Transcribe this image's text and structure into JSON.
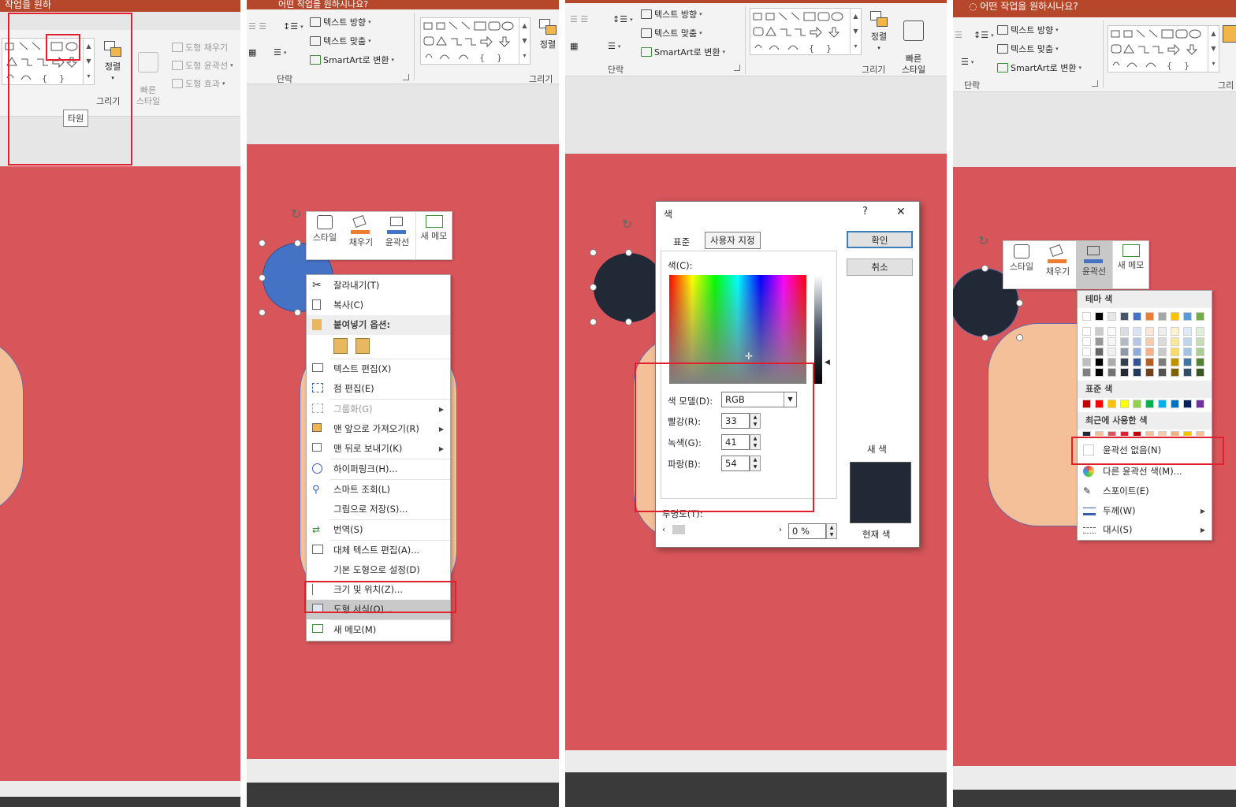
{
  "colors": {
    "title_bar": "#b7472a",
    "slide_bg": "#d8565a",
    "peach": "#f4c09a",
    "blue_circle": "#4472c4",
    "navy": "#212936",
    "highlight_red": "#e0202c"
  },
  "panel1": {
    "title_fragment": "작업을 원하",
    "arrange_label": "정렬",
    "quick_styles_label": "빠른\n스타일",
    "shape_fill": "도형 채우기",
    "shape_outline": "도형 윤곽선",
    "shape_effects": "도형 효과",
    "group_label": "그리기",
    "tooltip": "타원"
  },
  "panel2": {
    "title_fragment": "어떤 작업을 원하시나요?",
    "text_direction": "텍스트 방향",
    "align_text": "텍스트 맞춤",
    "smartart": "SmartArt로 변환",
    "paragraph_label": "단락",
    "drawing_label": "그리기",
    "arrange_label": "정렬",
    "minitoolbar": [
      "스타일",
      "채우기",
      "윤곽선",
      "새 메모"
    ],
    "context_menu": [
      {
        "label": "잘라내기(T)",
        "icon": "scissors-icon"
      },
      {
        "label": "복사(C)",
        "icon": "copy-icon"
      },
      {
        "label": "붙여넣기 옵션:",
        "icon": "paste-icon",
        "header": true
      },
      {
        "label": "텍스트 편집(X)",
        "icon": "edit-text-icon"
      },
      {
        "label": "점 편집(E)",
        "icon": "edit-points-icon"
      },
      {
        "label": "그룹화(G)",
        "icon": "group-icon",
        "disabled": true,
        "submenu": true
      },
      {
        "label": "맨 앞으로 가져오기(R)",
        "icon": "bring-front-icon",
        "submenu": true
      },
      {
        "label": "맨 뒤로 보내기(K)",
        "icon": "send-back-icon",
        "submenu": true
      },
      {
        "label": "하이퍼링크(H)...",
        "icon": "hyperlink-icon"
      },
      {
        "label": "스마트 조회(L)",
        "icon": "smart-lookup-icon"
      },
      {
        "label": "그림으로 저장(S)...",
        "icon": ""
      },
      {
        "label": "번역(S)",
        "icon": "translate-icon"
      },
      {
        "label": "대체 텍스트 편집(A)...",
        "icon": "alt-text-icon"
      },
      {
        "label": "기본 도형으로 설정(D)",
        "icon": ""
      },
      {
        "label": "크기 및 위치(Z)...",
        "icon": "size-position-icon"
      },
      {
        "label": "도형 서식(O)...",
        "icon": "format-shape-icon",
        "highlight": true
      },
      {
        "label": "새 메모(M)",
        "icon": "new-comment-icon"
      }
    ]
  },
  "panel3": {
    "text_direction": "텍스트 방향",
    "align_text": "텍스트 맞춤",
    "smartart": "SmartArt로 변환",
    "paragraph_label": "단락",
    "drawing_label": "그리기",
    "arrange_label": "정렬",
    "quick_styles_label": "빠른\n스타일",
    "dialog": {
      "title": "색",
      "help": "?",
      "close": "✕",
      "tab_standard": "표준",
      "tab_custom": "사용자 지정",
      "colors_label": "색(C):",
      "model_label": "색 모델(D):",
      "model_value": "RGB",
      "red_label": "빨강(R):",
      "red_value": "33",
      "green_label": "녹색(G):",
      "green_value": "41",
      "blue_label": "파랑(B):",
      "blue_value": "54",
      "transparency_label": "투명도(T):",
      "transparency_value": "0 %",
      "ok": "확인",
      "cancel": "취소",
      "new_label": "새 색",
      "current_label": "현재 색"
    }
  },
  "panel4": {
    "title": "어떤 작업을 원하시나요?",
    "text_direction": "텍스트 방향",
    "align_text": "텍스트 맞춤",
    "smartart": "SmartArt로 변환",
    "paragraph_label": "단락",
    "drawing_label": "그리",
    "minitoolbar": [
      "스타일",
      "채우기",
      "윤곽선",
      "새 메모"
    ],
    "dropdown": {
      "theme_colors": "테마 색",
      "standard_colors": "표준 색",
      "recent_colors": "최근에 사용한 색",
      "no_outline": "윤곽선 없음(N)",
      "more_colors": "다른 윤곽선 색(M)...",
      "eyedropper": "스포이트(E)",
      "weight": "두께(W)",
      "dashes": "대시(S)"
    },
    "theme_top": [
      "#ffffff",
      "#000000",
      "#e7e6e6",
      "#44546a",
      "#4472c4",
      "#ed7d31",
      "#a5a5a5",
      "#ffc000",
      "#5b9bd5",
      "#70ad47"
    ],
    "standard": [
      "#c00000",
      "#ff0000",
      "#ffc000",
      "#ffff00",
      "#92d050",
      "#00b050",
      "#00b0f0",
      "#0070c0",
      "#002060",
      "#7030a0"
    ],
    "recent": [
      "#212936",
      "#f4c09a",
      "#d8565a",
      "#e0202c",
      "#c00000",
      "#f4c09a",
      "#f8cbad",
      "#f4b183",
      "#ffc000",
      "#f4c09a"
    ]
  }
}
